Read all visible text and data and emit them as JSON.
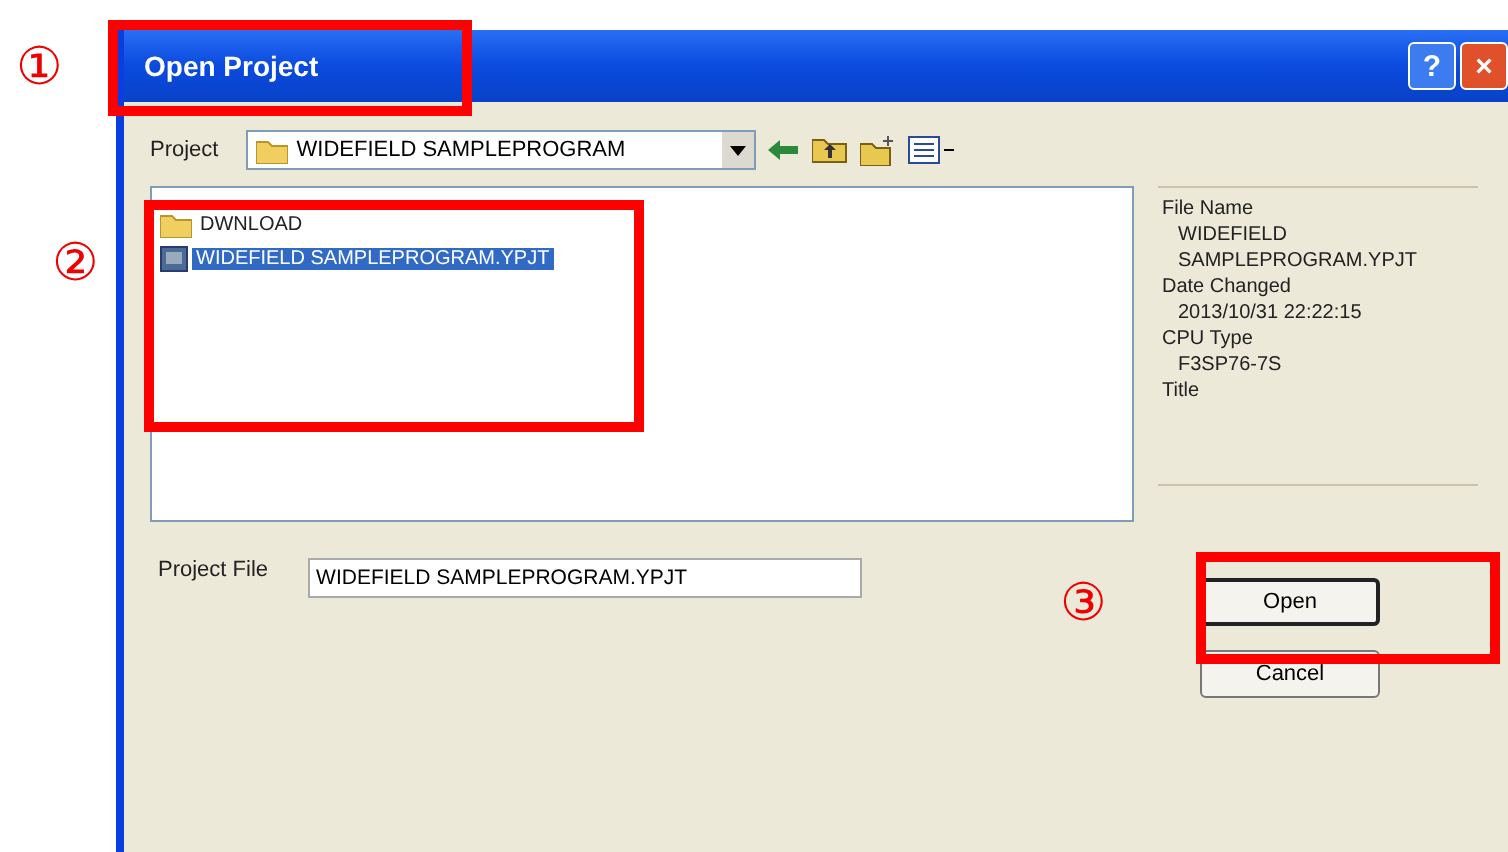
{
  "window": {
    "title": "Open Project",
    "help": "?",
    "close": "×"
  },
  "toolbar": {
    "label": "Project",
    "folder": "WIDEFIELD SAMPLEPROGRAM"
  },
  "files": [
    {
      "name": "DWNLOAD",
      "kind": "folder",
      "selected": false
    },
    {
      "name": "WIDEFIELD SAMPLEPROGRAM.YPJT",
      "kind": "project",
      "selected": true
    }
  ],
  "info": [
    {
      "label": "File Name",
      "value": "WIDEFIELD SAMPLEPROGRAM.YPJT"
    },
    {
      "label": "Date Changed",
      "value": "2013/10/31 22:22:15"
    },
    {
      "label": "CPU Type",
      "value": "F3SP76-7S"
    },
    {
      "label": "Title"
    }
  ],
  "project_file": {
    "label": "Project File",
    "value": "WIDEFIELD SAMPLEPROGRAM.YPJT"
  },
  "buttons": [
    {
      "label": "Open",
      "default": true
    },
    {
      "label": "Cancel",
      "default": false
    }
  ],
  "callouts": [
    {
      "number": "①"
    },
    {
      "number": "②"
    },
    {
      "number": "③"
    }
  ]
}
